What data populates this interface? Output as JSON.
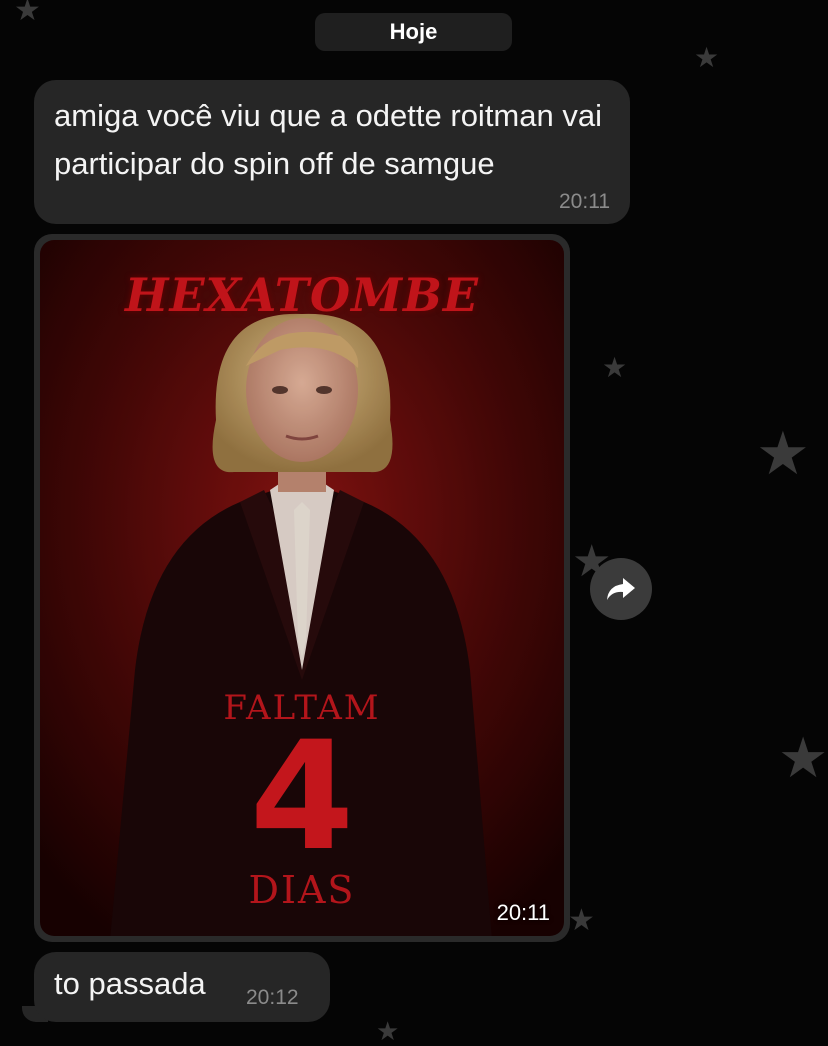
{
  "date_separator": "Hoje",
  "messages": [
    {
      "text": "amiga você viu que a odette roitman vai participar do spin off de samgue",
      "time": "20:11"
    },
    {
      "type": "image",
      "time": "20:11",
      "poster": {
        "title": "HEXATOMBE",
        "line1": "FALTAM",
        "number": "4",
        "line2": "DIAS"
      }
    },
    {
      "text": "to passada",
      "time": "20:12"
    }
  ],
  "icons": {
    "forward": "forward-arrow-icon",
    "background_stars": "star-icon"
  },
  "colors": {
    "background": "#050505",
    "bubble": "#262626",
    "poster_red": "#c3161c"
  }
}
